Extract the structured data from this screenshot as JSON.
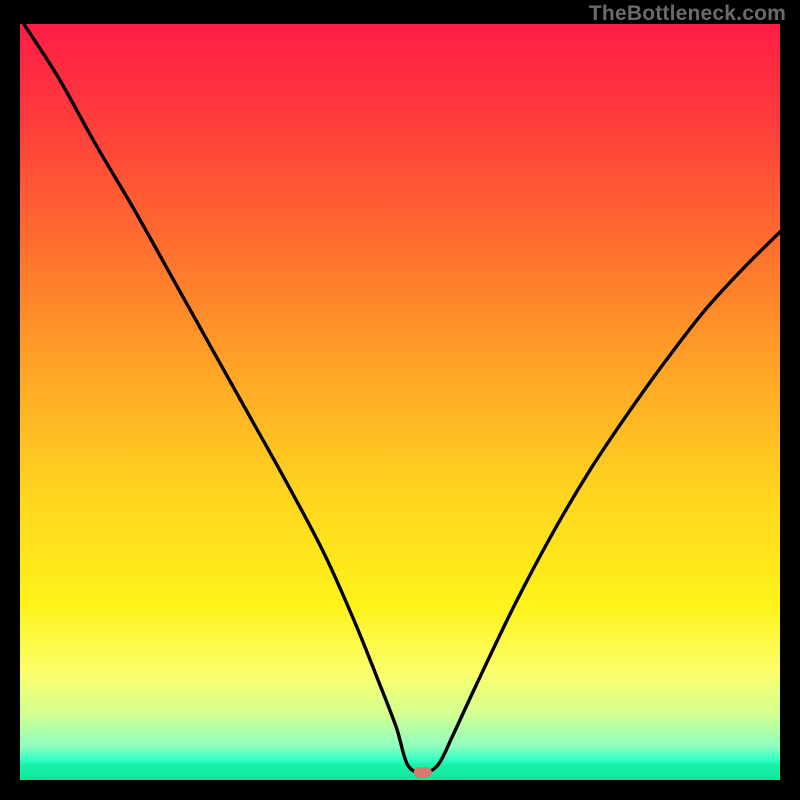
{
  "watermark": "TheBottleneck.com",
  "colors": {
    "page_bg": "#000000",
    "curve_stroke": "#000000",
    "marker_fill": "#d97a6f",
    "gradient_top": "#ff1c47",
    "gradient_bottom": "#14e59c"
  },
  "chart_data": {
    "type": "line",
    "title": "",
    "xlabel": "",
    "ylabel": "",
    "xlim": [
      0,
      100
    ],
    "ylim": [
      0,
      100
    ],
    "grid": false,
    "legend": false,
    "annotations": [
      {
        "type": "marker",
        "x": 53,
        "y": 1,
        "shape": "rounded-rect",
        "color": "#d97a6f"
      }
    ],
    "series": [
      {
        "name": "bottleneck-curve",
        "x": [
          0.5,
          5,
          10,
          15,
          20,
          25,
          30,
          35,
          40,
          44,
          47,
          49.5,
          51,
          53,
          55,
          57,
          60,
          65,
          70,
          75,
          80,
          85,
          90,
          95,
          100
        ],
        "y": [
          100,
          93,
          84,
          75.5,
          66.5,
          57.5,
          48.5,
          39.5,
          30,
          21,
          13.5,
          7,
          2,
          1,
          2,
          6,
          12.5,
          23,
          32.5,
          41,
          48.5,
          55.5,
          62,
          67.5,
          72.5
        ]
      }
    ]
  }
}
